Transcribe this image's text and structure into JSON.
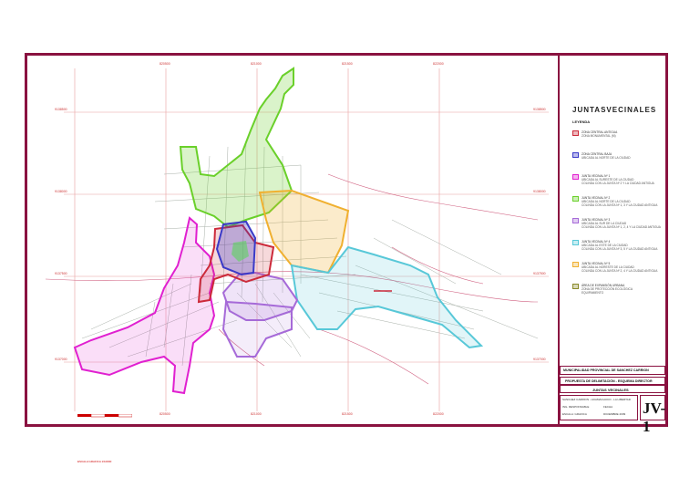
{
  "colors": {
    "frame": "#8a1240",
    "grid": "#e8a0a0",
    "streets": "#a8b0a8",
    "rivers": "#d06080",
    "zones": {
      "historic_core": "#cc2a3a",
      "north_center": "#3a3ac8",
      "jv1": "#e020d0",
      "jv2": "#6ad02a",
      "jv3": "#a66ad8",
      "jv4": "#58c8d8",
      "jv5": "#f0b030",
      "expansion": "#8a8a2a"
    }
  },
  "legend": {
    "title": "JUNTASVECINALES",
    "subtitle": "LEYENDA",
    "items": [
      {
        "color_key": "historic_core",
        "line1": "ZONA CENTRAL ANTIGUA",
        "line2": "ZONA MONUMENTAL (M)",
        "line3": ""
      },
      {
        "color_key": "north_center",
        "line1": "ZONA CENTRAL BAJA",
        "line2": "UBICADA AL NORTE DE LA CIUDAD",
        "line3": ""
      },
      {
        "color_key": "jv1",
        "line1": "JUNTA VECINAL Nº 1",
        "line2": "UBICADA AL SURESTE DE LA CIUDAD",
        "line3": "COLINDA CON LA JUNTA Nº 2 Y LA CIUDAD ANTIGUA"
      },
      {
        "color_key": "jv2",
        "line1": "JUNTA VECINAL Nº 2",
        "line2": "UBICADA AL NORTE DE LA CIUDAD",
        "line3": "COLINDA CON LA JUNTA Nº 1, 3 Y LA CIUDAD ANTIGUA"
      },
      {
        "color_key": "jv3",
        "line1": "JUNTA VECINAL Nº 3",
        "line2": "UBICADA AL SUR DE LA CIUDAD",
        "line3": "COLINDA CON LA JUNTA Nº 1, 2, 4 Y LA CIUDAD ANTIGUA"
      },
      {
        "color_key": "jv4",
        "line1": "JUNTA VECINAL Nº 4",
        "line2": "UBICADA AL ESTE DE LA CIUDAD",
        "line3": "COLINDA CON LA JUNTA Nº 3, 5 Y LA CIUDAD ANTIGUA"
      },
      {
        "color_key": "jv5",
        "line1": "JUNTA VECINAL Nº 5",
        "line2": "UBICADA AL NORESTE DE LA CIUDAD",
        "line3": "COLINDA CON LA JUNTA Nº 2, 4 Y LA CIUDAD ANTIGUA"
      },
      {
        "color_key": "expansion",
        "line1": "ÁREA DE EXPANSIÓN URBANA",
        "line2": "ZONA DE PROTECCIÓN ECOLÓGICA",
        "line3": "EQUIPAMIENTO"
      }
    ]
  },
  "titleblock": {
    "municipality": "MUNICIPALIDAD PROVINCIAL DE SANCHEZ CARRION",
    "proposal": "PROPUESTA DE DELIMITACIÓN - ESQUEMA DIRECTOR",
    "sheet_title": "JUNTAS VECINALES",
    "row1_left": "SANCHEZ CARRION - HUAMACHUCO - LA LIBERTAD",
    "row2_left": "ING. RESPONSABLE",
    "row2_mid": "FECHA",
    "row3_left": "ESCALA: GRAFICA",
    "row3_mid": "DICIEMBRE 2009",
    "code": "JV-1"
  },
  "grid": {
    "x_labels": [
      "820500",
      "821000",
      "821500",
      "822000"
    ],
    "y_labels": [
      "9138500",
      "9138000",
      "9137500",
      "9137000"
    ]
  },
  "scale_note": "ESCALA GRAFICA   1/10000"
}
